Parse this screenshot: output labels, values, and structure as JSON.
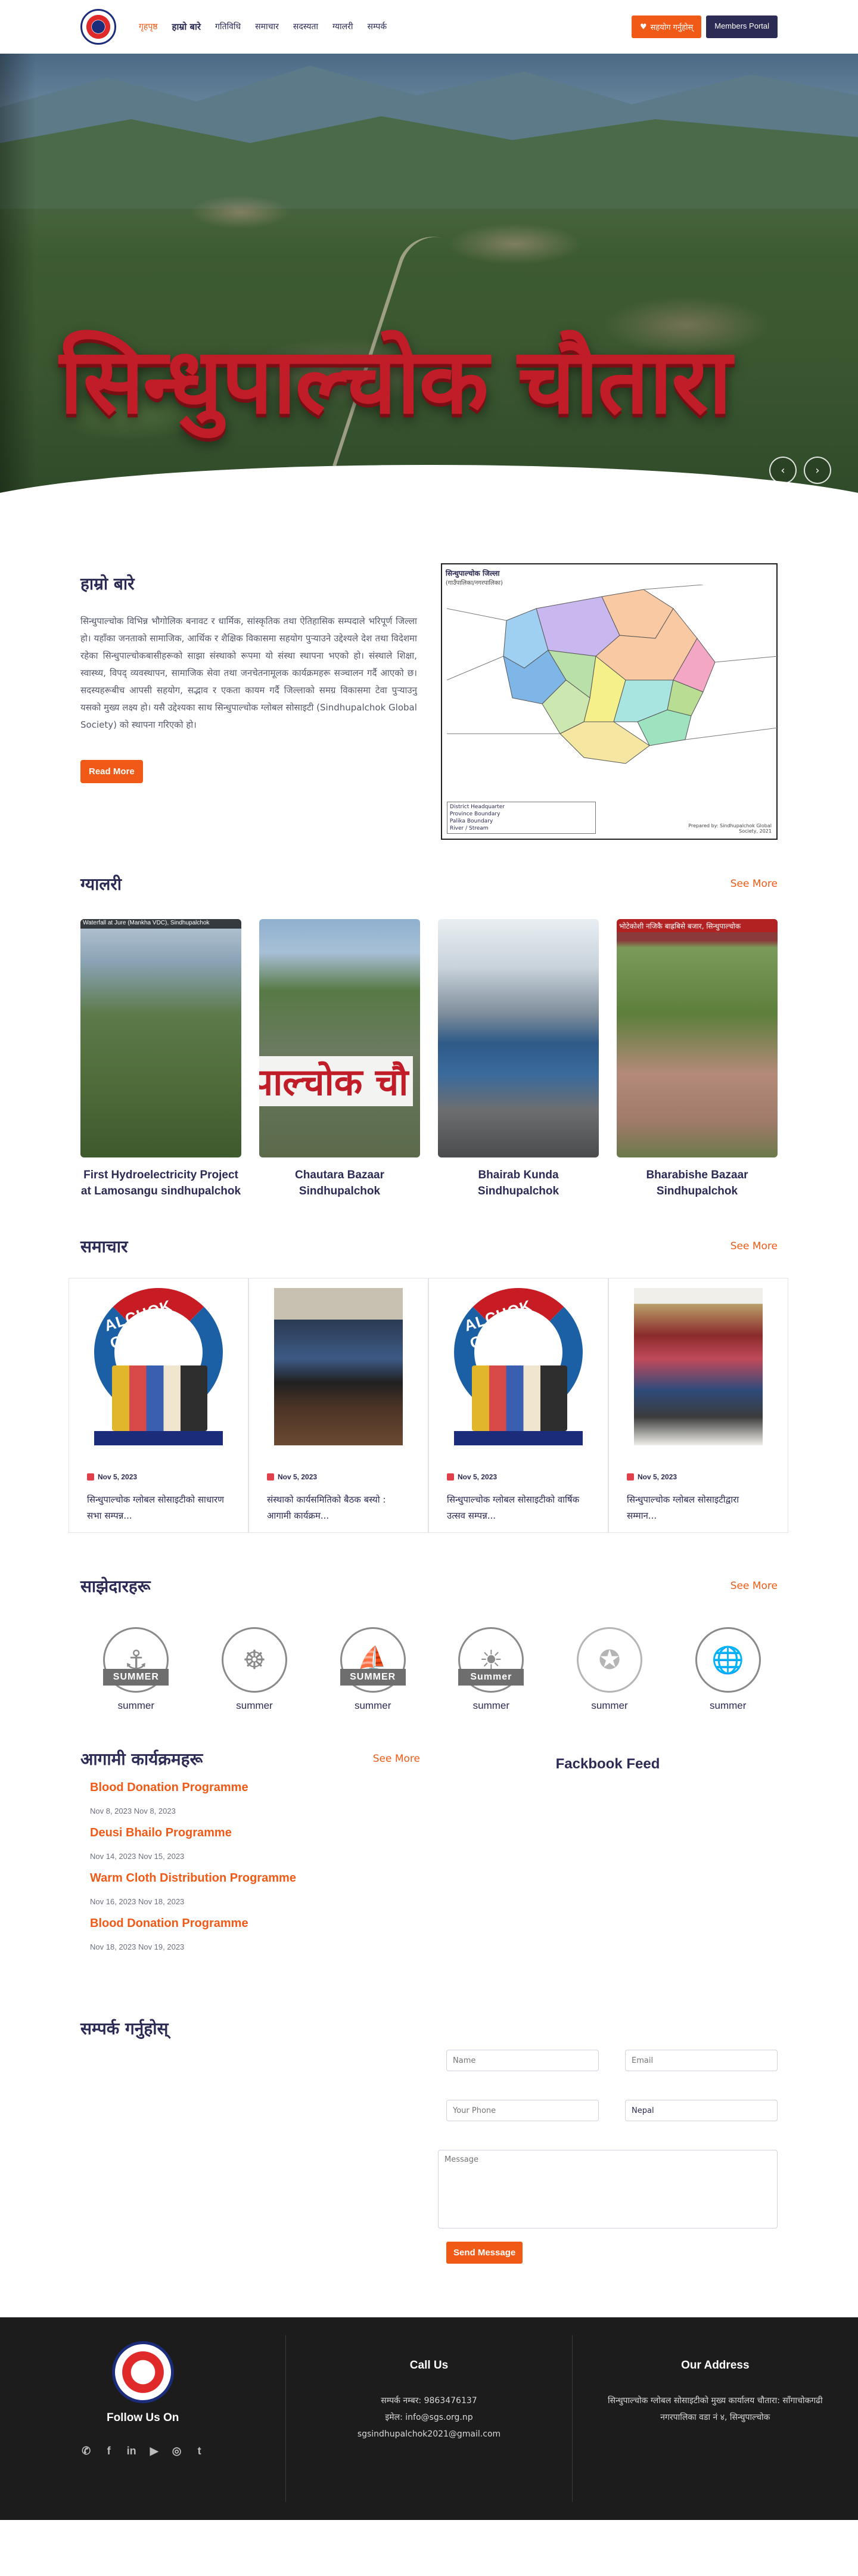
{
  "header": {
    "nav": [
      "गृहपृष्ठ",
      "हाम्रो बारे",
      "गतिविधि",
      "समाचार",
      "सदस्यता",
      "ग्यालरी",
      "सम्पर्क"
    ],
    "donate_label": "सहयोग गर्नुहोस्",
    "portal_label": "Members Portal"
  },
  "hero": {
    "title": "सिन्धुपाल्चोक चौतारा"
  },
  "about": {
    "title": "हाम्रो बारे",
    "text": "सिन्धुपाल्चोक विभिन्न भौगोलिक बनावट र धार्मिक, सांस्कृतिक तथा ऐतिहासिक सम्पदाले भरिपूर्ण जिल्ला हो। यहाँका जनताको सामाजिक, आर्थिक र शैक्षिक विकासमा सहयोग पुर्‍याउने उद्देश्यले देश तथा विदेशमा रहेका सिन्धुपाल्चोकबासीहरूको साझा संस्थाको रूपमा यो संस्था स्थापना भएको हो। संस्थाले शिक्षा, स्वास्थ्य, विपद् व्यवस्थापन, सामाजिक सेवा तथा जनचेतनामूलक कार्यक्रमहरू सञ्चालन गर्दै आएको छ। सदस्यहरूबीच आपसी सहयोग, सद्भाव र एकता कायम गर्दै जिल्लाको समग्र विकासमा टेवा पुर्‍याउनु यसको मुख्य लक्ष्य हो। यसै उद्देश्यका साथ सिन्धुपाल्चोक ग्लोबल सोसाइटी (Sindhupalchok Global Society) को स्थापना गरिएको हो।",
    "read_more": "Read More",
    "map": {
      "title": "सिन्धुपाल्चोक जिल्ला",
      "subtitle": "(गाउँपालिका/नगरपालिका)",
      "regions": [
        "Bhotekoshi Gaunpalika",
        "Jugal Gaunpalika",
        "Panchpokhari Thangpal Gaunpalika",
        "Helambu Gaunpalika",
        "Melamchi Nagarpalika",
        "Indrawati Gaunpalika",
        "Chautara Sangachokgadhi Nagarpalika",
        "Balefi Gaunpalika",
        "Barhabise Nagarpalika",
        "Lisankhu Pakhar Gaunpalika",
        "Sunkoshi Gaunpalika",
        "Tripurasundari Gaunpalika"
      ],
      "neighbors": [
        "CHINA",
        "Rasuwa",
        "Nuwakot",
        "Kathmandu",
        "Kavrepalanchowk",
        "Dolakha",
        "Ramechhap"
      ],
      "legend": [
        "District Headquarter",
        "Province Boundary",
        "Palika Boundary",
        "River / Stream"
      ],
      "note": "Prepared by: Sindhupalchok Global Society, 2021"
    }
  },
  "gallery": {
    "title": "ग्यालरी",
    "see_more": "See More",
    "items": [
      {
        "caption": "First Hydroelectricity Project at Lamosangu sindhupalchok",
        "strip": "Waterfall at Jure (Mankha VDC), Sindhupalchok"
      },
      {
        "caption": "Chautara Bazaar Sindhupalchok",
        "overlay": "पाल्चोक चौ"
      },
      {
        "caption": "Bhairab Kunda Sindhupalchok"
      },
      {
        "caption": "Bharabishe Bazaar Sindhupalchok",
        "strip": "भोटेकोशी नजिकै बाह्रबिसे बजार, सिन्धुपाल्चोक"
      }
    ]
  },
  "news": {
    "title": "समाचार",
    "see_more": "See More",
    "items": [
      {
        "date": "Nov 5, 2023",
        "title": "सिन्धुपाल्चोक ग्लोबल सोसाइटीको साधारण सभा सम्पन्न...",
        "banner": "ALCHOK GLOBAL"
      },
      {
        "date": "Nov 5, 2023",
        "title": "संस्थाको कार्यसमितिको बैठक बस्यो : आगामी कार्यक्रम...",
        "banner": ""
      },
      {
        "date": "Nov 5, 2023",
        "title": "सिन्धुपाल्चोक ग्लोबल सोसाइटीको वार्षिक उत्सव सम्पन्न...",
        "banner": "ALCHOK GLOBAL"
      },
      {
        "date": "Nov 5, 2023",
        "title": "सिन्धुपाल्चोक ग्लोबल सोसाइटीद्वारा सम्मान...",
        "banner": ""
      }
    ]
  },
  "partners": {
    "title": "साझेदारहरू",
    "see_more": "See More",
    "items": [
      {
        "label": "summer",
        "ribbon": "SUMMER"
      },
      {
        "label": "summer",
        "ribbon": ""
      },
      {
        "label": "summer",
        "ribbon": "SUMMER"
      },
      {
        "label": "summer",
        "ribbon": "Summer"
      },
      {
        "label": "summer",
        "ribbon": ""
      },
      {
        "label": "summer",
        "ribbon": ""
      }
    ]
  },
  "events": {
    "title": "आगामी कार्यक्रमहरू",
    "see_more": "See More",
    "items": [
      {
        "title": "Blood Donation Programme",
        "date": "Nov 8, 2023 Nov 8, 2023"
      },
      {
        "title": "Deusi Bhailo Programme",
        "date": "Nov 14, 2023 Nov 15, 2023"
      },
      {
        "title": "Warm Cloth Distribution Programme",
        "date": "Nov 16, 2023 Nov 18, 2023"
      },
      {
        "title": "Blood Donation Programme",
        "date": "Nov 18, 2023 Nov 19, 2023"
      }
    ],
    "facebook_title": "Fackbook Feed"
  },
  "contact": {
    "title": "सम्पर्क गर्नुहोस्",
    "name_placeholder": "Name",
    "email_placeholder": "Email",
    "phone_placeholder": "Your Phone",
    "country_value": "Nepal",
    "message_placeholder": "Message",
    "send_label": "Send Message"
  },
  "footer": {
    "follow_label": "Follow Us On",
    "call_title": "Call Us",
    "call_lines": [
      "सम्पर्क नम्बर: 9863476137",
      "इमेल: info@sgs.org.np",
      "sgsindhupalchok2021@gmail.com"
    ],
    "address_title": "Our Address",
    "address_lines": [
      "सिन्धुपाल्चोक ग्लोबल सोसाइटीको मुख्य कार्यालय चौतारा: साँगाचोकगढी",
      "नगरपालिका वडा नं ४, सिन्धुपाल्चोक"
    ],
    "socials": [
      "phone",
      "facebook",
      "linkedin",
      "youtube",
      "instagram",
      "twitter"
    ]
  }
}
